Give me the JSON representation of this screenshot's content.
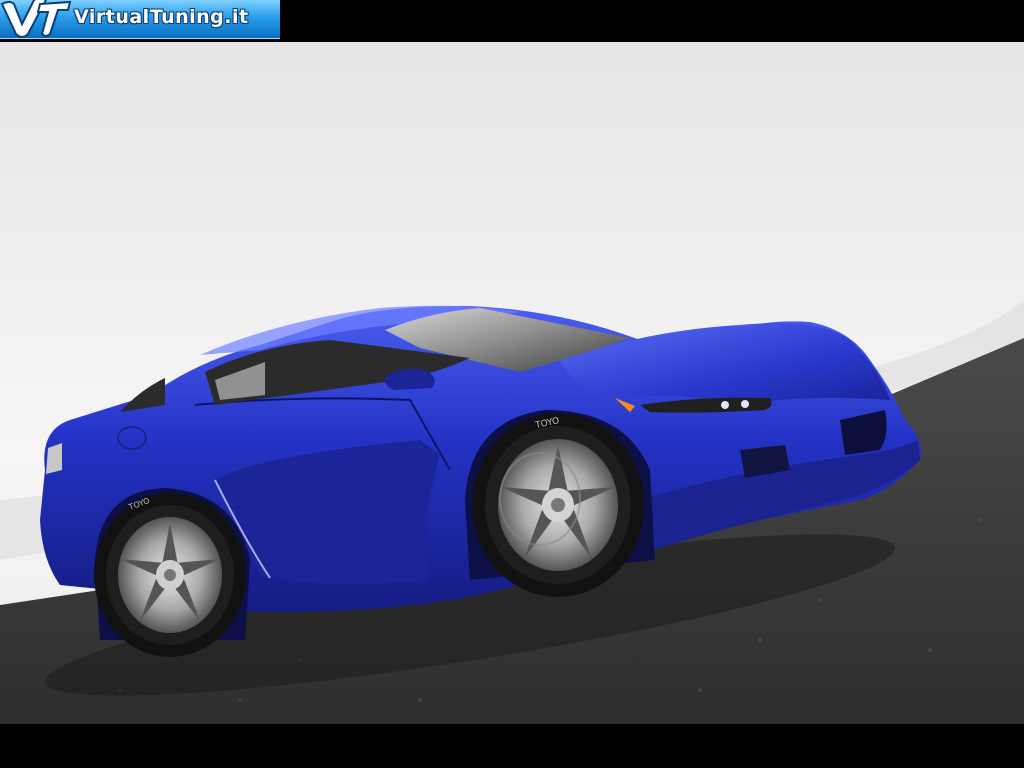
{
  "watermark": {
    "brand_text": "VirtualTuning.it",
    "logo_icon": "vt-logo-icon"
  },
  "scene": {
    "tire_brand": "TOYO",
    "colors": {
      "car_body": "#2230b8",
      "car_highlight": "#5a6cf0",
      "sky": "#f2f2f2",
      "ground": "#3a3a3a",
      "logo_blue": "#2a9ee8"
    }
  }
}
